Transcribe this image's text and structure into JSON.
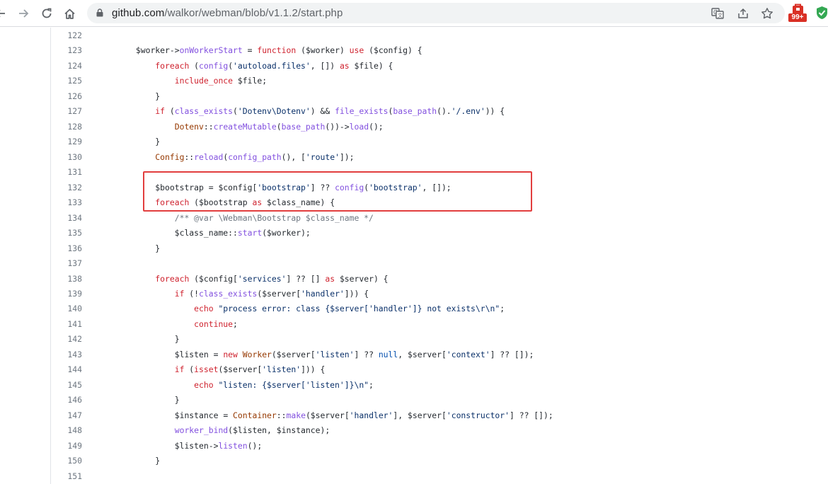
{
  "browser": {
    "url_domain": "github.com",
    "url_path": "/walkor/webman/blob/v1.1.2/start.php",
    "badge": "99+",
    "colors": {
      "badge": "#d93025",
      "toolbar": "#ffffff",
      "omnibox": "#f1f3f4"
    }
  },
  "code": {
    "lines": [
      {
        "n": "122",
        "t": ""
      },
      {
        "n": "123",
        "t": "        $worker->onWorkerStart = function ($worker) use ($config) {"
      },
      {
        "n": "124",
        "t": "            foreach (config('autoload.files', []) as $file) {"
      },
      {
        "n": "125",
        "t": "                include_once $file;"
      },
      {
        "n": "126",
        "t": "            }"
      },
      {
        "n": "127",
        "t": "            if (class_exists('Dotenv\\Dotenv') && file_exists(base_path().'/.env')) {"
      },
      {
        "n": "128",
        "t": "                Dotenv::createMutable(base_path())->load();"
      },
      {
        "n": "129",
        "t": "            }"
      },
      {
        "n": "130",
        "t": "            Config::reload(config_path(), ['route']);"
      },
      {
        "n": "131",
        "t": ""
      },
      {
        "n": "132",
        "t": "            $bootstrap = $config['bootstrap'] ?? config('bootstrap', []);"
      },
      {
        "n": "133",
        "t": "            foreach ($bootstrap as $class_name) {"
      },
      {
        "n": "134",
        "t": "                /** @var \\Webman\\Bootstrap $class_name */"
      },
      {
        "n": "135",
        "t": "                $class_name::start($worker);"
      },
      {
        "n": "136",
        "t": "            }"
      },
      {
        "n": "137",
        "t": ""
      },
      {
        "n": "138",
        "t": "            foreach ($config['services'] ?? [] as $server) {"
      },
      {
        "n": "139",
        "t": "                if (!class_exists($server['handler'])) {"
      },
      {
        "n": "140",
        "t": "                    echo \"process error: class {$server['handler']} not exists\\r\\n\";"
      },
      {
        "n": "141",
        "t": "                    continue;"
      },
      {
        "n": "142",
        "t": "                }"
      },
      {
        "n": "143",
        "t": "                $listen = new Worker($server['listen'] ?? null, $server['context'] ?? []);"
      },
      {
        "n": "144",
        "t": "                if (isset($server['listen'])) {"
      },
      {
        "n": "145",
        "t": "                    echo \"listen: {$server['listen']}\\n\";"
      },
      {
        "n": "146",
        "t": "                }"
      },
      {
        "n": "147",
        "t": "                $instance = Container::make($server['handler'], $server['constructor'] ?? []);"
      },
      {
        "n": "148",
        "t": "                worker_bind($listen, $instance);"
      },
      {
        "n": "149",
        "t": "                $listen->listen();"
      },
      {
        "n": "150",
        "t": "            }"
      },
      {
        "n": "151",
        "t": ""
      }
    ]
  },
  "icons": {
    "back": "arrow-left-icon",
    "forward": "arrow-right-icon",
    "reload": "reload-icon",
    "home": "home-icon",
    "lock": "lock-icon",
    "translate": "translate-icon",
    "share": "share-icon",
    "bookmark": "star-icon",
    "extension": "extension-icon",
    "shield": "shield-check-icon"
  }
}
